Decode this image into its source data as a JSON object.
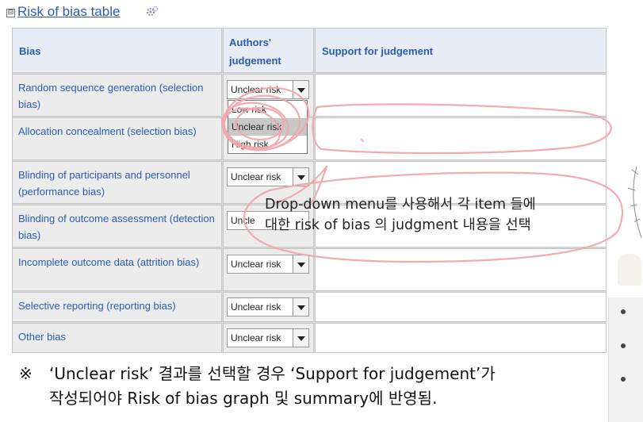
{
  "section": {
    "toggle": "⊟",
    "title": "Risk of bias table"
  },
  "table": {
    "headers": {
      "bias": "Bias",
      "judgement_line1": "Authors'",
      "judgement_line2": "judgement",
      "support": "Support for judgement"
    },
    "rows": [
      {
        "bias": "Random sequence generation (selection bias)",
        "judgement": "Unclear risk"
      },
      {
        "bias": "Allocation concealment (selection bias)",
        "judgement": "Unclear risk"
      },
      {
        "bias": "Blinding of participants and personnel (performance bias)",
        "judgement": "Unclear risk"
      },
      {
        "bias": "Blinding of outcome assessment (detection bias)",
        "judgement": "Uncle"
      },
      {
        "bias": "Incomplete outcome data (attrition bias)",
        "judgement": "Unclear risk"
      },
      {
        "bias": "Selective reporting (reporting bias)",
        "judgement": "Unclear risk"
      },
      {
        "bias": "Other bias",
        "judgement": "Unclear risk"
      }
    ]
  },
  "dropdown": {
    "options": [
      "Low risk",
      "Unclear risk",
      "High risk"
    ],
    "selected": "Unclear risk"
  },
  "annotation": {
    "callout_line1": "Drop-down menu를 사용해서 각 item 들에",
    "callout_line2": "대한 risk of bias 의 judgment 내용을 선택",
    "color": "#f1a7ad"
  },
  "note": {
    "mark": "※",
    "line1": "‘Unclear risk’ 결과를 선택할 경우 ‘Support for judgement’가",
    "line2": "작성되어야 Risk of bias graph 및 summary에 반영됨."
  }
}
